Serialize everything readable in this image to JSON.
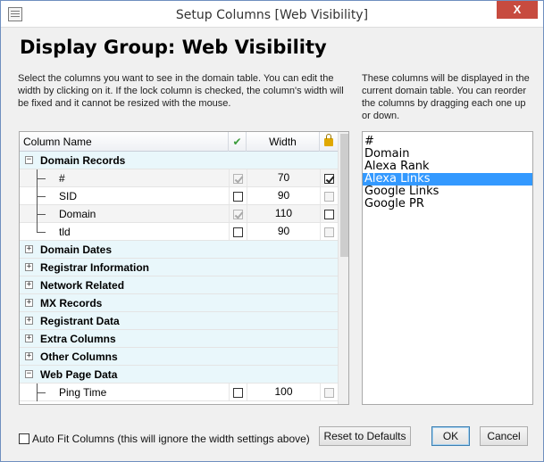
{
  "window": {
    "title": "Setup Columns [Web Visibility]",
    "close_glyph": "X"
  },
  "dialog": {
    "header": "Display Group: Web Visibility",
    "left_description": "Select the columns you want to see in the domain table. You can edit the width by clicking on it. If the lock column is checked, the column's width will be fixed and it cannot be resized with the mouse.",
    "right_description": "These columns will be displayed in the current domain table. You can reorder the columns by dragging each one up or down."
  },
  "grid": {
    "headers": {
      "name": "Column Name",
      "visible": "✔",
      "width": "Width",
      "lock_icon": "lock-icon"
    },
    "rows": [
      {
        "type": "group",
        "label": "Domain Records",
        "expander": "−"
      },
      {
        "type": "item",
        "label": "#",
        "visible": true,
        "visible_disabled": true,
        "width": "70",
        "lock": true,
        "lock_disabled": false,
        "shaded": true
      },
      {
        "type": "item",
        "label": "SID",
        "visible": false,
        "visible_disabled": false,
        "width": "90",
        "lock": false,
        "lock_disabled": true,
        "shaded": false
      },
      {
        "type": "item",
        "label": "Domain",
        "visible": true,
        "visible_disabled": true,
        "width": "110",
        "lock": false,
        "lock_disabled": false,
        "shaded": true
      },
      {
        "type": "item",
        "label": "tld",
        "visible": false,
        "visible_disabled": false,
        "width": "90",
        "lock": false,
        "lock_disabled": true,
        "shaded": false,
        "last": true
      },
      {
        "type": "group",
        "label": "Domain Dates",
        "expander": "+"
      },
      {
        "type": "group",
        "label": "Registrar Information",
        "expander": "+"
      },
      {
        "type": "group",
        "label": "Network Related",
        "expander": "+"
      },
      {
        "type": "group",
        "label": "MX Records",
        "expander": "+"
      },
      {
        "type": "group",
        "label": "Registrant Data",
        "expander": "+"
      },
      {
        "type": "group",
        "label": "Extra Columns",
        "expander": "+"
      },
      {
        "type": "group",
        "label": "Other Columns",
        "expander": "+"
      },
      {
        "type": "group",
        "label": "Web Page Data",
        "expander": "−"
      },
      {
        "type": "item",
        "label": "Ping Time",
        "visible": false,
        "visible_disabled": false,
        "width": "100",
        "lock": false,
        "lock_disabled": true,
        "shaded": false
      }
    ]
  },
  "display_list": {
    "items": [
      "#",
      "Domain",
      "Alexa Rank",
      "Alexa Links",
      "Google Links",
      "Google PR"
    ],
    "selected_index": 3
  },
  "footer": {
    "autofit_label": "Auto Fit Columns (this will ignore the width settings above)",
    "autofit_checked": false,
    "reset_label": "Reset to Defaults",
    "ok_label": "OK",
    "cancel_label": "Cancel"
  }
}
